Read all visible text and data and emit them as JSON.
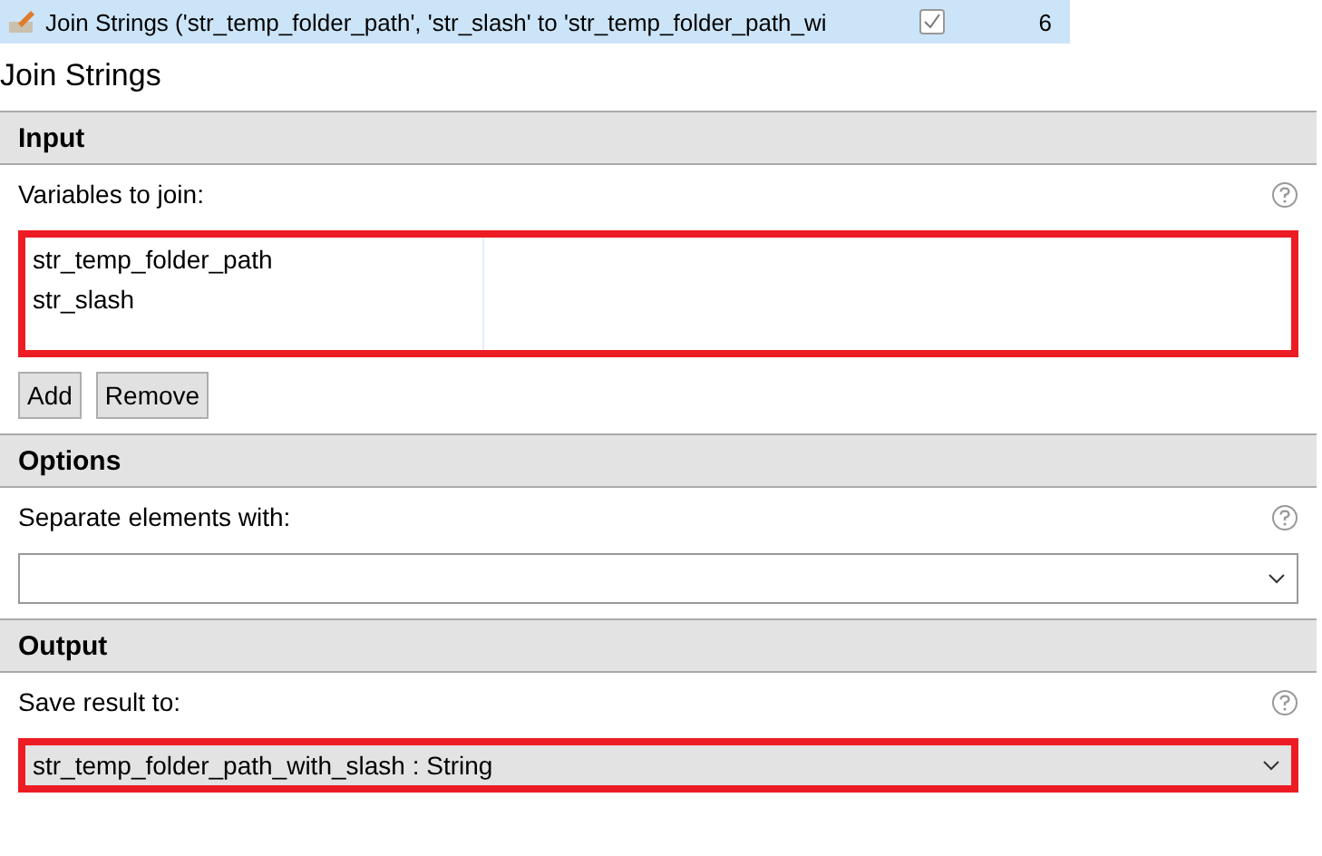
{
  "step_row": {
    "label": "Join Strings ('str_temp_folder_path', 'str_slash' to 'str_temp_folder_path_wi",
    "checked": true,
    "number": "6",
    "selected": true
  },
  "title": "Join Strings",
  "sections": [
    {
      "header": "Input",
      "fields": [
        {
          "kind": "list",
          "label": "Variables to join:",
          "highlighted": true,
          "items": [
            "str_temp_folder_path",
            "str_slash"
          ],
          "buttons": [
            "Add",
            "Remove"
          ]
        }
      ]
    },
    {
      "header": "Options",
      "fields": [
        {
          "kind": "select",
          "label": "Separate elements with:",
          "highlighted": false
        }
      ]
    },
    {
      "header": "Output",
      "fields": [
        {
          "kind": "select",
          "label": "Save result to:",
          "highlighted": true,
          "value": "str_temp_folder_path_with_slash : String"
        }
      ]
    }
  ]
}
